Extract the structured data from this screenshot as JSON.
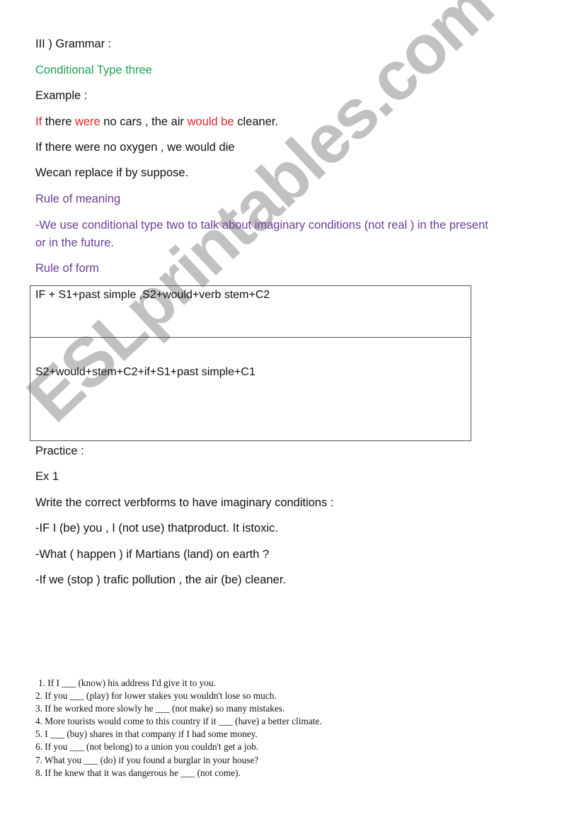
{
  "section_heading": "III ) Grammar :",
  "topic_title": "Conditional Type three",
  "example_label": "Example :",
  "example_1": {
    "if": "If",
    "part1": " there ",
    "were": "were",
    "part2": " no cars , the air ",
    "would_be": "would be",
    "part3": " cleaner."
  },
  "example_2": "If there were no oxygen , we would die",
  "replace_note": "Wecan replace if by suppose.",
  "rule_of_meaning_heading": "Rule of meaning",
  "rule_of_meaning_line1": "-We use conditional type two to talk about imaginary conditions (not  real ) in the present",
  "rule_of_meaning_line2": "or in the future.",
  "rule_of_form_heading": "Rule of form",
  "form_table": {
    "rows": [
      "IF  + S1+past simple ,S2+would+verb stem+C2",
      "S2+would+stem+C2+if+S1+past simple+C1"
    ]
  },
  "practice_label": " Practice :",
  "exercise_1": {
    "label": "Ex 1",
    "instruction": "Write the correct verbforms to have imaginary conditions :",
    "items": [
      "-IF I (be) you  , I (not use) thatproduct. It istoxic.",
      "-What ( happen ) if Martians (land) on earth ?",
      "-If we (stop ) trafic pollution , the air (be) cleaner."
    ]
  },
  "exercise_2": {
    "items": [
      "1. If I ___ (know) his address I'd give it to you.",
      "2. If you ___ (play) for lower stakes you wouldn't lose so much.",
      "3. If he worked more slowly he ___ (not make) so many mistakes.",
      "4. More tourists would come to this country if it ___ (have) a better climate.",
      "5. I ___ (buy) shares in that company if I had some money.",
      "6. If you ___ (not belong) to a union you couldn't get a job.",
      "7. What you ___ (do) if you found a burglar in your house?",
      "8. If he knew that it was dangerous he ___ (not come)."
    ]
  },
  "watermark": "ESLprintables.com",
  "colors": {
    "title_green": "#1fa150",
    "highlight_red": "#e0242a",
    "rule_purple": "#6a3d9a",
    "watermark_gray": "#b4b4b4"
  }
}
